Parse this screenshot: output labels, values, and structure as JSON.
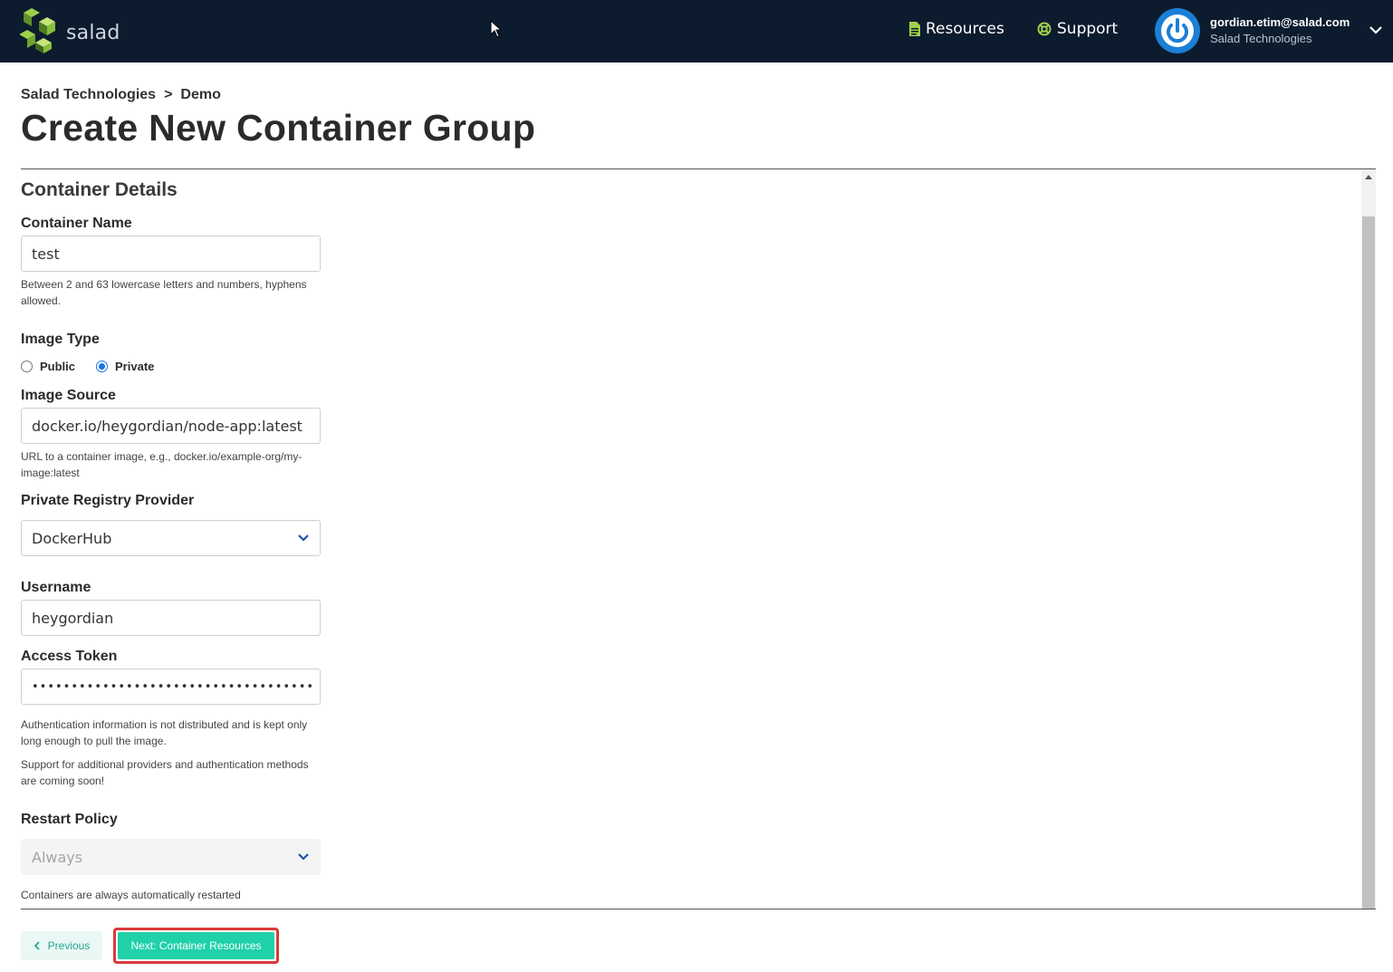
{
  "header": {
    "brand": "salad",
    "nav": {
      "resources_label": "Resources",
      "support_label": "Support"
    },
    "user": {
      "email": "gordian.etim@salad.com",
      "org": "Salad Technologies"
    }
  },
  "breadcrumb": {
    "org": "Salad Technologies",
    "separator": ">",
    "project": "Demo"
  },
  "page_title": "Create New Container Group",
  "form": {
    "section_title": "Container Details",
    "container_name": {
      "label": "Container Name",
      "value": "test",
      "help": "Between 2 and 63 lowercase letters and numbers, hyphens allowed."
    },
    "image_type": {
      "label": "Image Type",
      "options": [
        "Public",
        "Private"
      ],
      "selected": "Private"
    },
    "image_source": {
      "label": "Image Source",
      "value": "docker.io/heygordian/node-app:latest",
      "help": "URL to a container image, e.g., docker.io/example-org/my-image:latest"
    },
    "registry_provider": {
      "label": "Private Registry Provider",
      "value": "DockerHub"
    },
    "username": {
      "label": "Username",
      "value": "heygordian"
    },
    "access_token": {
      "label": "Access Token",
      "value": "••••••••••••••••••••••••••••••••••••",
      "help1": "Authentication information is not distributed and is kept only long enough to pull the image.",
      "help2": "Support for additional providers and authentication methods are coming soon!"
    },
    "restart_policy": {
      "label": "Restart Policy",
      "value": "Always",
      "help": "Containers are always automatically restarted"
    }
  },
  "footer": {
    "previous_label": "Previous",
    "next_label": "Next: Container Resources"
  },
  "colors": {
    "topbar": "#0c1b2e",
    "accent_green": "#9ed14a",
    "primary_button": "#1fd1a9",
    "highlight_outline": "#d93a3a",
    "avatar_blue": "#1b7fd6"
  },
  "icons": {
    "logo": "salad-logo-icon",
    "resources": "document-icon",
    "support": "lifebuoy-icon",
    "avatar": "power-icon",
    "user_menu": "chevron-down-icon",
    "select": "chevron-down-icon",
    "previous": "chevron-left-icon",
    "cursor": "mouse-pointer-icon"
  }
}
